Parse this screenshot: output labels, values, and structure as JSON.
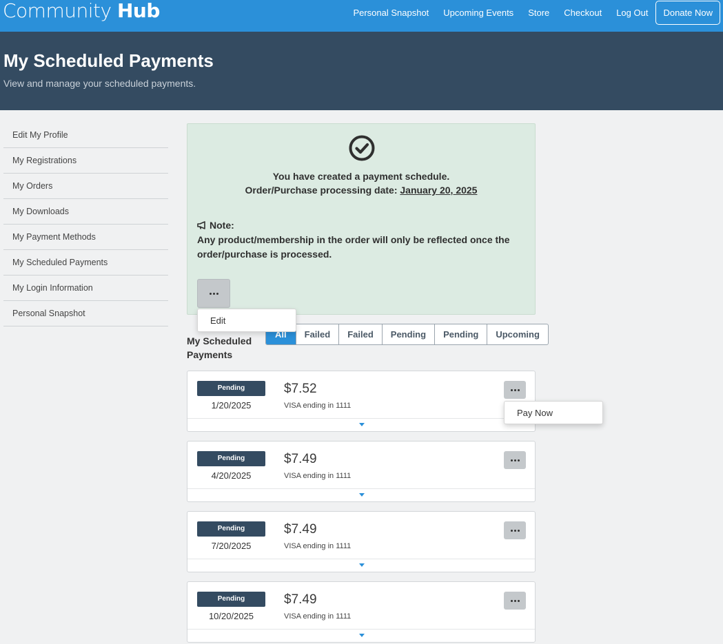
{
  "brand": {
    "light": "Community",
    "bold": "Hub"
  },
  "nav": {
    "items": [
      "Personal Snapshot",
      "Upcoming Events",
      "Store",
      "Checkout",
      "Log Out"
    ],
    "donate": "Donate Now"
  },
  "header": {
    "title": "My Scheduled Payments",
    "subtitle": "View and manage your scheduled payments."
  },
  "sidebar": {
    "items": [
      "Edit My Profile",
      "My Registrations",
      "My Orders",
      "My Downloads",
      "My Payment Methods",
      "My Scheduled Payments",
      "My Login Information",
      "Personal Snapshot"
    ]
  },
  "alert": {
    "line1": "You have created a payment schedule.",
    "line2_prefix": "Order/Purchase processing date: ",
    "line2_date": "January 20, 2025",
    "note_label": "Note:",
    "note_text": "Any product/membership in the order will only be reflected once the order/purchase is processed.",
    "menu_edit": "Edit"
  },
  "section": {
    "title": "My Scheduled Payments",
    "filters": [
      "All",
      "Failed",
      "Failed",
      "Pending",
      "Pending",
      "Upcoming"
    ],
    "active_filter": "All"
  },
  "payments": [
    {
      "status": "Pending",
      "date": "1/20/2025",
      "amount": "$7.52",
      "method": "VISA ending in 1111"
    },
    {
      "status": "Pending",
      "date": "4/20/2025",
      "amount": "$7.49",
      "method": "VISA ending in 1111"
    },
    {
      "status": "Pending",
      "date": "7/20/2025",
      "amount": "$7.49",
      "method": "VISA ending in 1111"
    },
    {
      "status": "Pending",
      "date": "10/20/2025",
      "amount": "$7.49",
      "method": "VISA ending in 1111"
    }
  ],
  "menu_paynow": "Pay Now",
  "colors": {
    "topbar": "#2b90d9",
    "header": "#344b61",
    "alert_bg": "#dcebe2",
    "badge": "#344b61",
    "accent": "#2b90d9"
  }
}
